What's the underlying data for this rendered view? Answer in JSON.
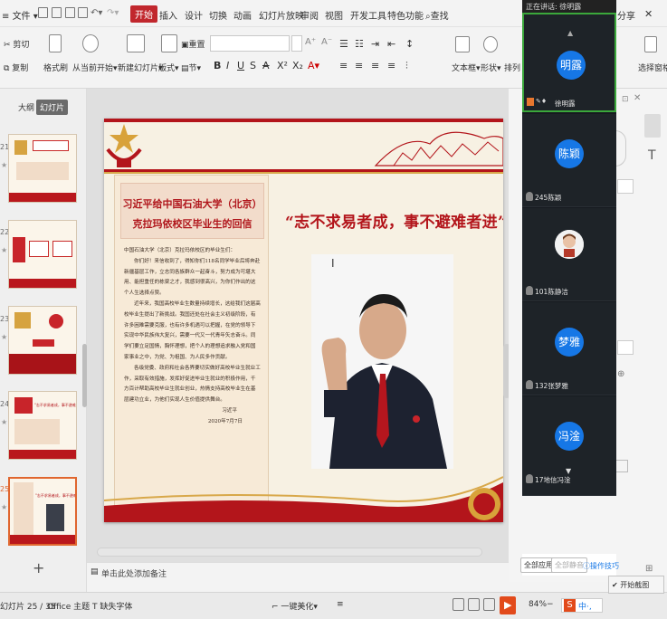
{
  "titlebar": {
    "file_menu": "文件",
    "tabs": [
      "开始",
      "插入",
      "设计",
      "切换",
      "动画",
      "幻灯片放映",
      "审阅",
      "视图",
      "开发工具",
      "特色功能"
    ],
    "active_tab": "开始",
    "search": "查找",
    "share": "分享"
  },
  "ribbon": {
    "cut": "剪切",
    "copy": "复制",
    "format_painter": "格式刷",
    "play_from_current": "从当前开始",
    "new_slide": "新建幻灯片",
    "layout": "版式",
    "section": "节",
    "reset": "重置",
    "textbox": "文本框",
    "shape": "形状",
    "arrange": "排列",
    "select_pane": "选择窗格"
  },
  "left_panel": {
    "outline_tab": "大纲",
    "slides_tab": "幻灯片",
    "slide_numbers": [
      "21",
      "22",
      "23",
      "24",
      "25"
    ],
    "thumb24_text": "\"志不求易者成，事不避难者进\"",
    "thumb25_text": "\"志不求易者成，事不避难者进\"",
    "add_icon": "plus-icon"
  },
  "slide": {
    "letter_title_1": "习近平给中国石油大学（北京）",
    "letter_title_2": "克拉玛依校区毕业生的回信",
    "letter_salutation": "中国石油大学（北京）克拉玛依校区的毕业生们：",
    "letter_p1": "你们好！来信收到了，得知你们118名同学毕业后将奔赴新疆基层工作，立志同各族群众一起奋斗，努力成为可堪大用、能担重任的栋梁之才，我感到很高兴，为你们作出的这个人生选择点赞。",
    "letter_p2": "近年来，我国高校毕业生数量持续增长，这给我们这届高校毕业生提出了新挑战。我国还处在社会主义初级阶段，有许多困难需要克服，也有许多机遇可以把握，在党的领导下实现中华民族伟大复兴，需要一代又一代青年矢志奋斗。同学们要立足国情，胸怀理想，把个人的理想追求融入党和国家事业之中，为党、为祖国、为人民多作贡献。",
    "letter_p3": "各级党委、政府和社会各界要切实做好高校毕业生就业工作，采取有效措施，发挥好促进毕业生就业的积极作用，千方百计帮助高校毕业生就业创业，热情支持高校毕业生在基层建功立业，为他们实现人生价值提供舞台。",
    "letter_signature": "习近平",
    "letter_date": "2020年7月7日",
    "slogan": "“志不求易者成，事不避难者进”"
  },
  "notes_placeholder": "单击此处添加备注",
  "meeting": {
    "speaker_label": "正在讲话: 徐明露",
    "participants": [
      {
        "avatar": "明露",
        "name": "徐明露",
        "active": true
      },
      {
        "avatar": "陈颖",
        "name": "245陈颖"
      },
      {
        "avatar": "",
        "name": "101陈静洁"
      },
      {
        "avatar": "梦雅",
        "name": "132张梦雅"
      },
      {
        "avatar": "冯淦",
        "name": "17地信冯淦"
      }
    ],
    "mute_all": "全部静音",
    "unmute_all": "全部应用",
    "tips": "操作技巧"
  },
  "status": {
    "slide_counter": "幻灯片 25 / 35",
    "theme": "Office 主题",
    "missing_font": "缺失字体",
    "beautify": "一键美化",
    "zoom": "84%",
    "start_capture": "开始截图"
  },
  "colors": {
    "accent": "#c1272d",
    "slide_red": "#b3151b",
    "meeting_bg": "#161a1f",
    "avatar_blue": "#1677e6"
  }
}
